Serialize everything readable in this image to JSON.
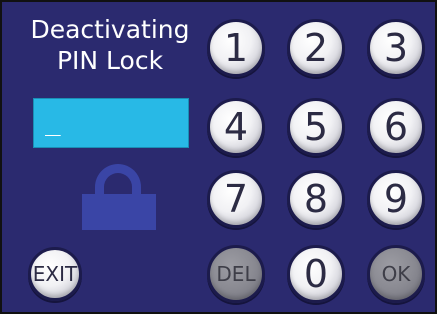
{
  "title": {
    "line1": "Deactivating",
    "line2": "PIN Lock"
  },
  "pin": {
    "value": "_"
  },
  "icons": {
    "lock": "lock-icon"
  },
  "keypad": {
    "k1": "1",
    "k2": "2",
    "k3": "3",
    "k4": "4",
    "k5": "5",
    "k6": "6",
    "k7": "7",
    "k8": "8",
    "k9": "9",
    "k0": "0",
    "del": "DEL",
    "ok": "OK",
    "exit": "EXIT"
  },
  "colors": {
    "background": "#2b2a6f",
    "pin_display": "#28b9e6",
    "lock": "#3a45a6",
    "key": "#f1f1f4",
    "key_disabled": "#8a8a92"
  }
}
